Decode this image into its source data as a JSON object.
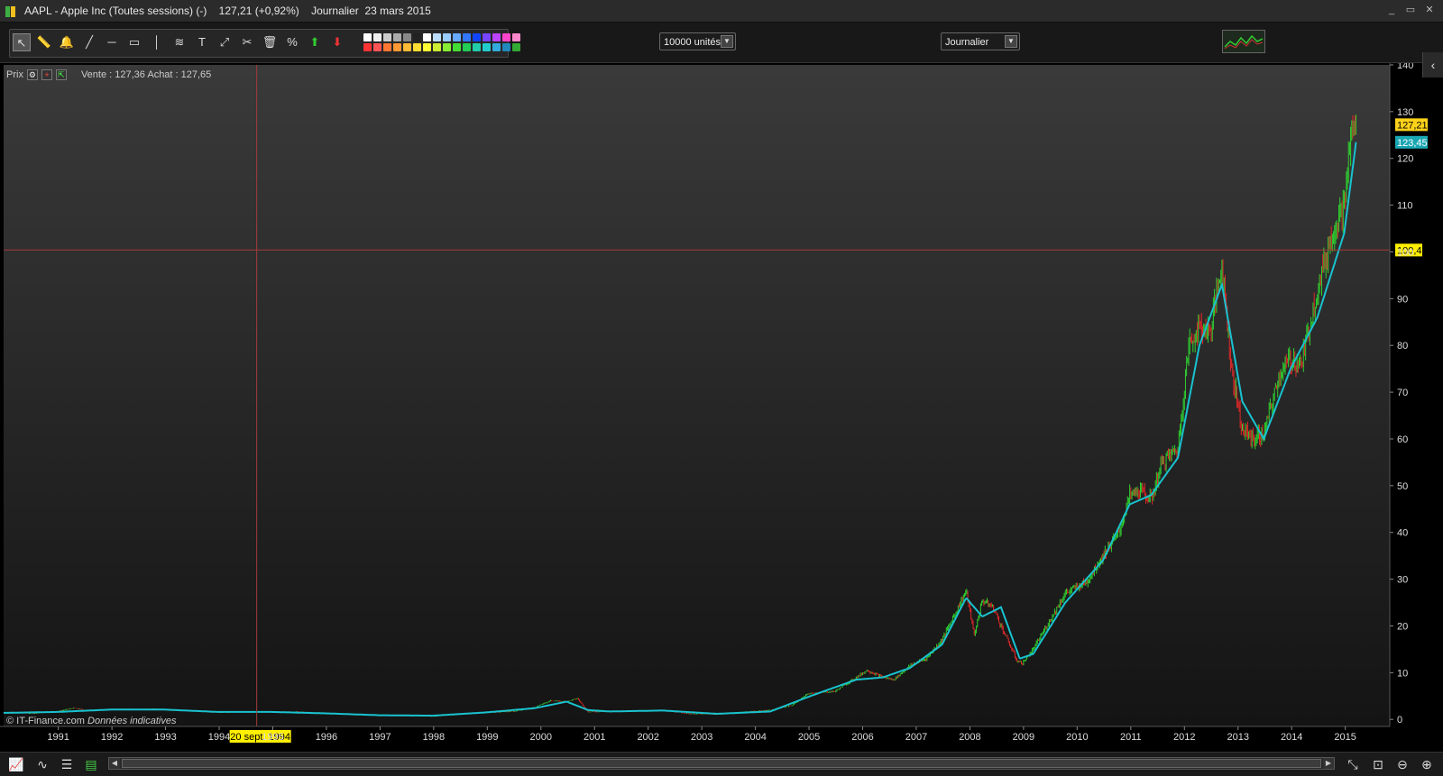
{
  "window": {
    "symbol": "AAPL",
    "instrument": "Apple Inc (Toutes sessions) (-)",
    "last_change": "127,21 (+0,92%)",
    "period": "Journalier",
    "date": "23 mars 2015",
    "controls": [
      "_",
      "▭",
      "✕"
    ]
  },
  "toolbar": {
    "units_dropdown": "10000 unités",
    "period_dropdown": "Journalier",
    "tools": [
      "cursor-tool",
      "ruler-tool",
      "alarm-tool",
      "line-tool",
      "horizontal-line-tool",
      "rectangle-tool",
      "vertical-line-tool",
      "fibonacci-tool",
      "text-tool",
      "arrow-tool",
      "settings-tool",
      "delete-tool",
      "percent-tool",
      "up-arrow-tool",
      "down-arrow-tool"
    ],
    "tool_glyphs": [
      "↖",
      "📏",
      "🔔",
      "╱",
      "─",
      "▭",
      "│",
      "≋",
      "T",
      "⤢",
      "✂",
      "🗑",
      "%",
      "⬆",
      "⬇"
    ],
    "colors": [
      "#ffffff",
      "#eeeeee",
      "#cccccc",
      "#aaaaaa",
      "#888888",
      "#222222",
      "#ffffff",
      "#bbddff",
      "#99ccff",
      "#66aaff",
      "#3377ff",
      "#1144ff",
      "#7744ff",
      "#bb44ff",
      "#ff44cc",
      "#ff88cc",
      "#ff3333",
      "#ff5555",
      "#ff7733",
      "#ff9933",
      "#ffbb33",
      "#ffdd33",
      "#ffff33",
      "#ccee33",
      "#88ee33",
      "#44dd33",
      "#22cc55",
      "#22ccaa",
      "#22cccc",
      "#33aadd",
      "#2288bb",
      "#33aa33"
    ],
    "collapse_glyph": "‹"
  },
  "panel": {
    "label": "Prix",
    "quote": "Vente : 127,36 Achat : 127,65",
    "credit_source": "© IT-Finance.com",
    "credit_note": "Données indicatives"
  },
  "bottom": {
    "left_icons": [
      "chart-type-icon",
      "indicator-icon",
      "list-icon",
      "compare-icon"
    ],
    "right_icons": [
      "zoom-fit-icon",
      "zoom-reset-icon",
      "zoom-out-icon",
      "zoom-in-icon"
    ]
  },
  "chart_data": {
    "type": "candlestick",
    "title": "",
    "price_axis_ticks": [
      0,
      10,
      20,
      30,
      40,
      50,
      60,
      70,
      80,
      90,
      100,
      110,
      120,
      130,
      140
    ],
    "ylim": [
      -1.5,
      140
    ],
    "x_ticks": [
      "1991",
      "1992",
      "1993",
      "1994",
      "1995",
      "1996",
      "1997",
      "1998",
      "1999",
      "2000",
      "2001",
      "2002",
      "2003",
      "2004",
      "2005",
      "2006",
      "2007",
      "2008",
      "2009",
      "2010",
      "2011",
      "2012",
      "2013",
      "2014",
      "2015"
    ],
    "xlim": [
      1990.0,
      2015.85
    ],
    "price_tags": [
      {
        "label": "127,21",
        "value": 127.21,
        "color": "#ffd21a"
      },
      {
        "label": "123,45",
        "value": 123.45,
        "color": "#1aa6b3"
      }
    ],
    "crosshair": {
      "date_label": "20 sept. 1994",
      "date": 1994.72,
      "price_label": "100,4",
      "price": 100.4
    },
    "series": [
      {
        "name": "Price",
        "color": "candles",
        "x": [
          1990.0,
          1990.5,
          1991.0,
          1991.3,
          1991.6,
          1992.0,
          1992.5,
          1993.0,
          1993.5,
          1994.0,
          1994.5,
          1995.0,
          1995.5,
          1996.0,
          1996.5,
          1997.0,
          1997.5,
          1998.0,
          1998.5,
          1999.0,
          1999.5,
          1999.9,
          2000.2,
          2000.5,
          2000.7,
          2000.9,
          2001.3,
          2001.8,
          2002.3,
          2002.8,
          2003.3,
          2003.8,
          2004.3,
          2004.7,
          2005.0,
          2005.5,
          2005.9,
          2006.1,
          2006.4,
          2006.6,
          2006.9,
          2007.2,
          2007.5,
          2007.8,
          2007.95,
          2008.1,
          2008.25,
          2008.45,
          2008.6,
          2008.9,
          2009.0,
          2009.2,
          2009.5,
          2009.8,
          2010.2,
          2010.5,
          2010.8,
          2011.0,
          2011.2,
          2011.4,
          2011.6,
          2011.9,
          2012.1,
          2012.3,
          2012.5,
          2012.72,
          2012.9,
          2013.1,
          2013.3,
          2013.5,
          2013.8,
          2014.0,
          2014.2,
          2014.5,
          2014.8,
          2015.0,
          2015.15,
          2015.22
        ],
        "close": [
          1.4,
          1.3,
          1.7,
          2.4,
          1.9,
          2.1,
          2.2,
          2.2,
          1.8,
          1.5,
          1.7,
          1.6,
          1.6,
          1.3,
          1.1,
          0.9,
          0.8,
          0.7,
          1.1,
          1.5,
          1.7,
          2.6,
          4.0,
          3.8,
          4.5,
          1.6,
          1.7,
          1.8,
          1.9,
          1.2,
          1.1,
          1.6,
          2.0,
          3.0,
          5.5,
          6.0,
          9.0,
          10.5,
          9.0,
          8.5,
          11.5,
          13.0,
          17.0,
          24.0,
          27.5,
          18.0,
          25.5,
          24.0,
          20.0,
          12.5,
          12.0,
          15.0,
          21.0,
          27.0,
          29.5,
          35.0,
          40.0,
          48.0,
          49.0,
          47.0,
          55.0,
          58.0,
          80.0,
          84.0,
          83.0,
          97.5,
          75.0,
          62.0,
          60.0,
          61.0,
          74.0,
          77.0,
          76.0,
          92.0,
          105.0,
          110.0,
          127.5,
          125.0
        ]
      },
      {
        "name": "Moving average",
        "color": "#19c2cf",
        "x": [
          1990.0,
          1991.0,
          1992.0,
          1993.0,
          1994.0,
          1995.0,
          1996.0,
          1997.0,
          1998.0,
          1999.0,
          1999.9,
          2000.5,
          2000.9,
          2001.3,
          2002.3,
          2003.3,
          2004.3,
          2005.0,
          2005.9,
          2006.4,
          2006.9,
          2007.5,
          2007.95,
          2008.25,
          2008.6,
          2008.95,
          2009.2,
          2009.8,
          2010.5,
          2011.0,
          2011.4,
          2011.9,
          2012.3,
          2012.72,
          2013.1,
          2013.5,
          2014.0,
          2014.5,
          2015.0,
          2015.22
        ],
        "values": [
          1.4,
          1.6,
          2.1,
          2.1,
          1.6,
          1.6,
          1.3,
          0.9,
          0.8,
          1.5,
          2.4,
          3.8,
          2.0,
          1.7,
          1.9,
          1.2,
          1.7,
          4.8,
          8.5,
          9.0,
          11.0,
          16.0,
          26.0,
          22.0,
          24.0,
          13.0,
          14.0,
          25.0,
          34.0,
          46.0,
          48.0,
          56.0,
          80.0,
          93.0,
          68.0,
          60.0,
          75.0,
          86.0,
          104.0,
          123.45
        ]
      }
    ],
    "grid": false,
    "legend": "none"
  }
}
